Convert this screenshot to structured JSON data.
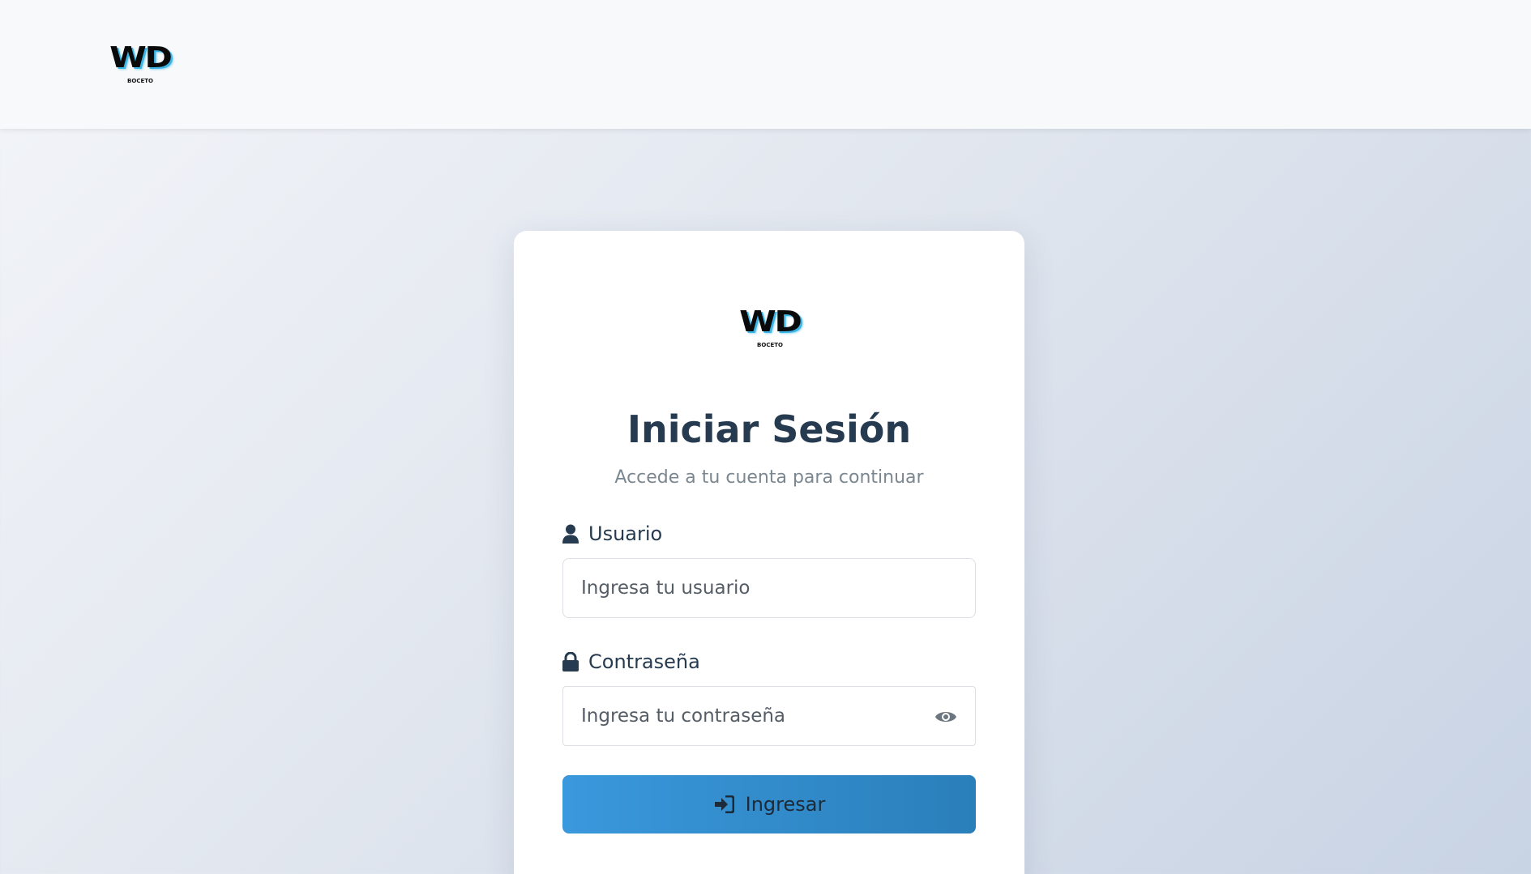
{
  "header": {
    "logo": {
      "mark": "WD",
      "sub": "BOCETO"
    }
  },
  "login": {
    "logo": {
      "mark": "WD",
      "sub": "BOCETO"
    },
    "title": "Iniciar Sesión",
    "subtitle": "Accede a tu cuenta para continuar",
    "username": {
      "label": "Usuario",
      "placeholder": "Ingresa tu usuario",
      "value": "",
      "icon": "user-icon"
    },
    "password": {
      "label": "Contraseña",
      "placeholder": "Ingresa tu contraseña",
      "value": "",
      "icon": "lock-icon",
      "toggle_icon": "eye-icon"
    },
    "submit": {
      "label": "Ingresar",
      "icon": "sign-in-icon"
    }
  },
  "colors": {
    "accent": "#3498db",
    "text_dark": "#263a50",
    "text_muted": "#7a8791",
    "logo_glow": "#3bb5e6"
  }
}
